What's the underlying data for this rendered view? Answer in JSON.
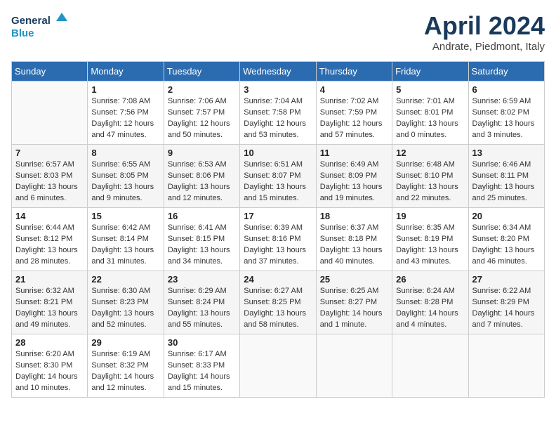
{
  "header": {
    "logo_line1": "General",
    "logo_line2": "Blue",
    "month": "April 2024",
    "location": "Andrate, Piedmont, Italy"
  },
  "weekdays": [
    "Sunday",
    "Monday",
    "Tuesday",
    "Wednesday",
    "Thursday",
    "Friday",
    "Saturday"
  ],
  "weeks": [
    [
      {
        "day": "",
        "sunrise": "",
        "sunset": "",
        "daylight": ""
      },
      {
        "day": "1",
        "sunrise": "Sunrise: 7:08 AM",
        "sunset": "Sunset: 7:56 PM",
        "daylight": "Daylight: 12 hours and 47 minutes."
      },
      {
        "day": "2",
        "sunrise": "Sunrise: 7:06 AM",
        "sunset": "Sunset: 7:57 PM",
        "daylight": "Daylight: 12 hours and 50 minutes."
      },
      {
        "day": "3",
        "sunrise": "Sunrise: 7:04 AM",
        "sunset": "Sunset: 7:58 PM",
        "daylight": "Daylight: 12 hours and 53 minutes."
      },
      {
        "day": "4",
        "sunrise": "Sunrise: 7:02 AM",
        "sunset": "Sunset: 7:59 PM",
        "daylight": "Daylight: 12 hours and 57 minutes."
      },
      {
        "day": "5",
        "sunrise": "Sunrise: 7:01 AM",
        "sunset": "Sunset: 8:01 PM",
        "daylight": "Daylight: 13 hours and 0 minutes."
      },
      {
        "day": "6",
        "sunrise": "Sunrise: 6:59 AM",
        "sunset": "Sunset: 8:02 PM",
        "daylight": "Daylight: 13 hours and 3 minutes."
      }
    ],
    [
      {
        "day": "7",
        "sunrise": "Sunrise: 6:57 AM",
        "sunset": "Sunset: 8:03 PM",
        "daylight": "Daylight: 13 hours and 6 minutes."
      },
      {
        "day": "8",
        "sunrise": "Sunrise: 6:55 AM",
        "sunset": "Sunset: 8:05 PM",
        "daylight": "Daylight: 13 hours and 9 minutes."
      },
      {
        "day": "9",
        "sunrise": "Sunrise: 6:53 AM",
        "sunset": "Sunset: 8:06 PM",
        "daylight": "Daylight: 13 hours and 12 minutes."
      },
      {
        "day": "10",
        "sunrise": "Sunrise: 6:51 AM",
        "sunset": "Sunset: 8:07 PM",
        "daylight": "Daylight: 13 hours and 15 minutes."
      },
      {
        "day": "11",
        "sunrise": "Sunrise: 6:49 AM",
        "sunset": "Sunset: 8:09 PM",
        "daylight": "Daylight: 13 hours and 19 minutes."
      },
      {
        "day": "12",
        "sunrise": "Sunrise: 6:48 AM",
        "sunset": "Sunset: 8:10 PM",
        "daylight": "Daylight: 13 hours and 22 minutes."
      },
      {
        "day": "13",
        "sunrise": "Sunrise: 6:46 AM",
        "sunset": "Sunset: 8:11 PM",
        "daylight": "Daylight: 13 hours and 25 minutes."
      }
    ],
    [
      {
        "day": "14",
        "sunrise": "Sunrise: 6:44 AM",
        "sunset": "Sunset: 8:12 PM",
        "daylight": "Daylight: 13 hours and 28 minutes."
      },
      {
        "day": "15",
        "sunrise": "Sunrise: 6:42 AM",
        "sunset": "Sunset: 8:14 PM",
        "daylight": "Daylight: 13 hours and 31 minutes."
      },
      {
        "day": "16",
        "sunrise": "Sunrise: 6:41 AM",
        "sunset": "Sunset: 8:15 PM",
        "daylight": "Daylight: 13 hours and 34 minutes."
      },
      {
        "day": "17",
        "sunrise": "Sunrise: 6:39 AM",
        "sunset": "Sunset: 8:16 PM",
        "daylight": "Daylight: 13 hours and 37 minutes."
      },
      {
        "day": "18",
        "sunrise": "Sunrise: 6:37 AM",
        "sunset": "Sunset: 8:18 PM",
        "daylight": "Daylight: 13 hours and 40 minutes."
      },
      {
        "day": "19",
        "sunrise": "Sunrise: 6:35 AM",
        "sunset": "Sunset: 8:19 PM",
        "daylight": "Daylight: 13 hours and 43 minutes."
      },
      {
        "day": "20",
        "sunrise": "Sunrise: 6:34 AM",
        "sunset": "Sunset: 8:20 PM",
        "daylight": "Daylight: 13 hours and 46 minutes."
      }
    ],
    [
      {
        "day": "21",
        "sunrise": "Sunrise: 6:32 AM",
        "sunset": "Sunset: 8:21 PM",
        "daylight": "Daylight: 13 hours and 49 minutes."
      },
      {
        "day": "22",
        "sunrise": "Sunrise: 6:30 AM",
        "sunset": "Sunset: 8:23 PM",
        "daylight": "Daylight: 13 hours and 52 minutes."
      },
      {
        "day": "23",
        "sunrise": "Sunrise: 6:29 AM",
        "sunset": "Sunset: 8:24 PM",
        "daylight": "Daylight: 13 hours and 55 minutes."
      },
      {
        "day": "24",
        "sunrise": "Sunrise: 6:27 AM",
        "sunset": "Sunset: 8:25 PM",
        "daylight": "Daylight: 13 hours and 58 minutes."
      },
      {
        "day": "25",
        "sunrise": "Sunrise: 6:25 AM",
        "sunset": "Sunset: 8:27 PM",
        "daylight": "Daylight: 14 hours and 1 minute."
      },
      {
        "day": "26",
        "sunrise": "Sunrise: 6:24 AM",
        "sunset": "Sunset: 8:28 PM",
        "daylight": "Daylight: 14 hours and 4 minutes."
      },
      {
        "day": "27",
        "sunrise": "Sunrise: 6:22 AM",
        "sunset": "Sunset: 8:29 PM",
        "daylight": "Daylight: 14 hours and 7 minutes."
      }
    ],
    [
      {
        "day": "28",
        "sunrise": "Sunrise: 6:20 AM",
        "sunset": "Sunset: 8:30 PM",
        "daylight": "Daylight: 14 hours and 10 minutes."
      },
      {
        "day": "29",
        "sunrise": "Sunrise: 6:19 AM",
        "sunset": "Sunset: 8:32 PM",
        "daylight": "Daylight: 14 hours and 12 minutes."
      },
      {
        "day": "30",
        "sunrise": "Sunrise: 6:17 AM",
        "sunset": "Sunset: 8:33 PM",
        "daylight": "Daylight: 14 hours and 15 minutes."
      },
      {
        "day": "",
        "sunrise": "",
        "sunset": "",
        "daylight": ""
      },
      {
        "day": "",
        "sunrise": "",
        "sunset": "",
        "daylight": ""
      },
      {
        "day": "",
        "sunrise": "",
        "sunset": "",
        "daylight": ""
      },
      {
        "day": "",
        "sunrise": "",
        "sunset": "",
        "daylight": ""
      }
    ]
  ]
}
